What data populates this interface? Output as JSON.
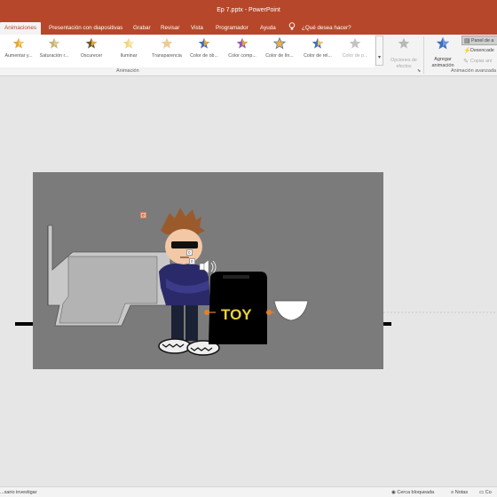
{
  "window": {
    "title": "Ep 7.pptx  -  PowerPoint"
  },
  "tabs": [
    {
      "label": "Animaciones",
      "active": true
    },
    {
      "label": "Presentación con diapositivas"
    },
    {
      "label": "Grabar"
    },
    {
      "label": "Revisar"
    },
    {
      "label": "Vista"
    },
    {
      "label": "Programador"
    },
    {
      "label": "Ayuda"
    },
    {
      "label": "¿Qué desea hacer?"
    }
  ],
  "ribbon": {
    "effects": [
      {
        "label": "Aumentar y...",
        "icon": "star-grow-icon"
      },
      {
        "label": "Saturación r...",
        "icon": "star-saturate-icon"
      },
      {
        "label": "Oscurecer",
        "icon": "star-darken-icon"
      },
      {
        "label": "Iluminar",
        "icon": "star-lighten-icon"
      },
      {
        "label": "Transparencia",
        "icon": "star-transparency-icon"
      },
      {
        "label": "Color de ob...",
        "icon": "star-object-color-icon"
      },
      {
        "label": "Color comp...",
        "icon": "star-complementary-color-icon"
      },
      {
        "label": "Color de lín...",
        "icon": "star-line-color-icon"
      },
      {
        "label": "Color de rel...",
        "icon": "star-fill-color-icon"
      },
      {
        "label": "Color de p...",
        "icon": "star-font-color-icon",
        "disabled": true
      }
    ],
    "effect_options": "Opciones de efectos",
    "group_animation": "Animación",
    "add_animation": "Agregar animación",
    "panel_label": "Panel de a",
    "trigger_label": "Desencade",
    "copy_label": "Copiar ani",
    "group_advanced": "Animación avanzada"
  },
  "slide": {
    "tags": [
      "0",
      "0",
      "0"
    ],
    "label_toy": "TOY"
  },
  "status": {
    "left": "...sario investigar",
    "accessibility": "Cerca bloqueada",
    "notes": "Notas",
    "comments": "Co"
  },
  "colors": {
    "accent": "#b7472a",
    "slide_bg": "#7b7b7b",
    "workspace": "#e6e6e6"
  }
}
